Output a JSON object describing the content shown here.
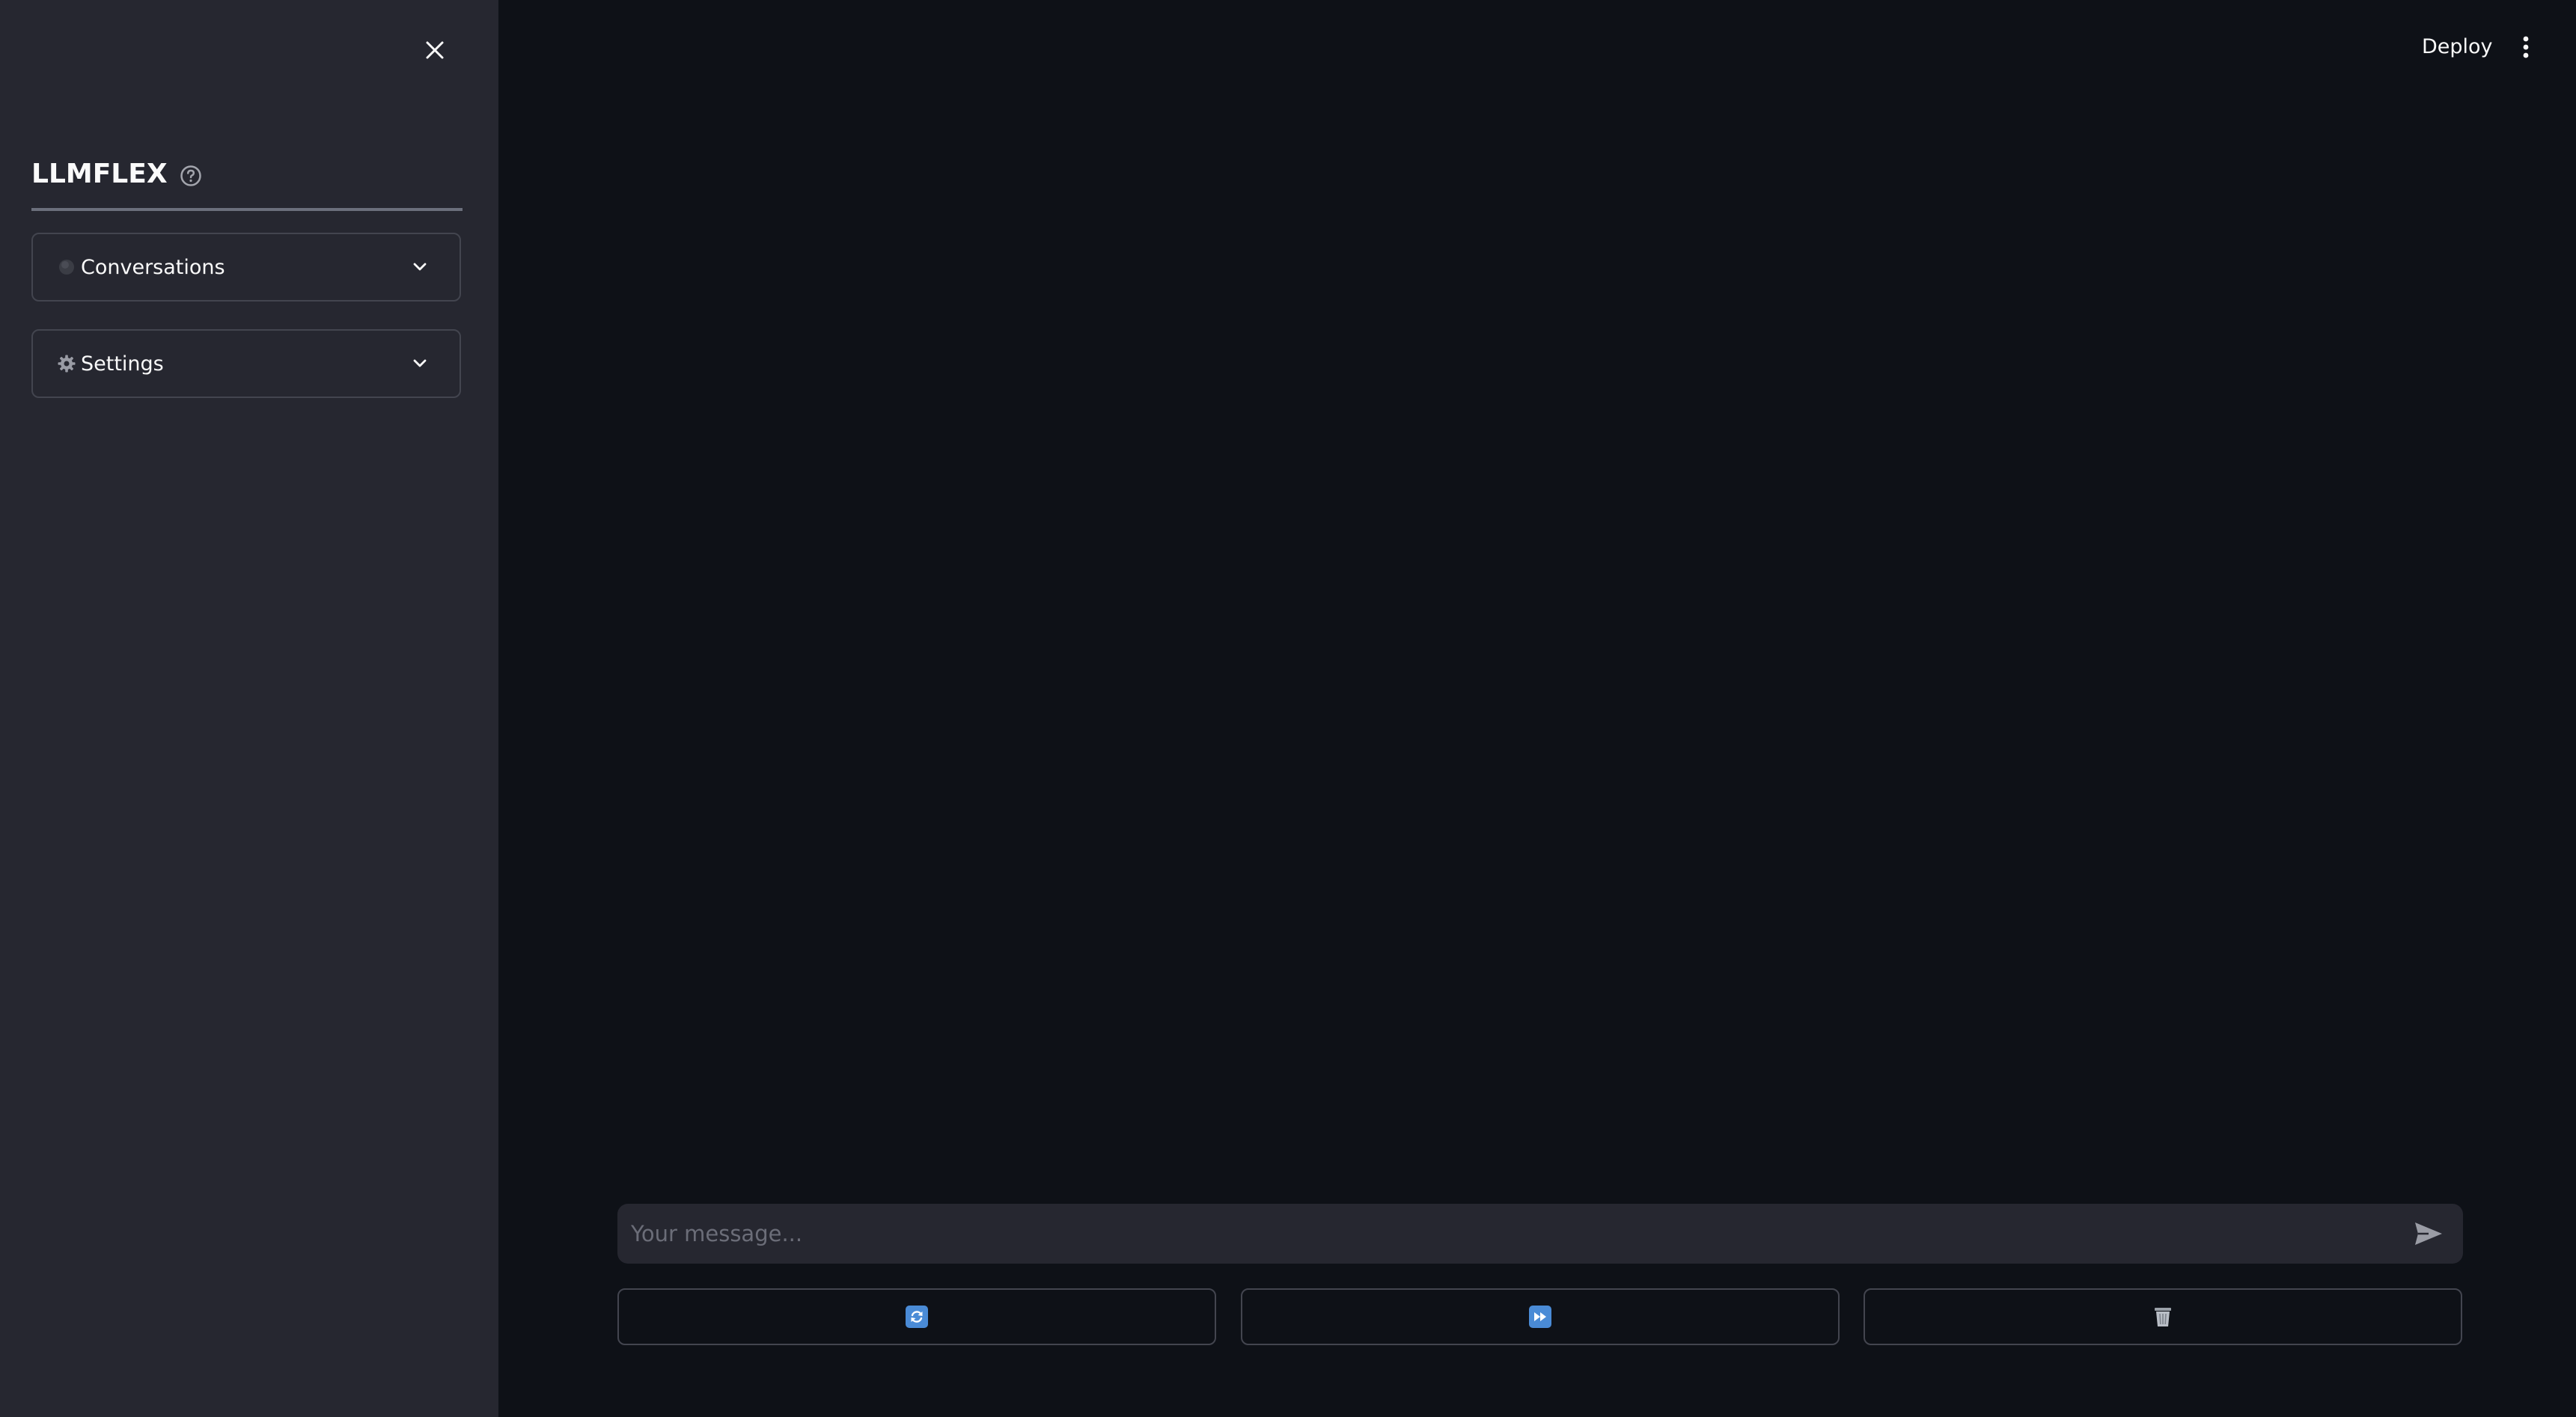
{
  "sidebar": {
    "title": "LLMFLEX",
    "expanders": [
      {
        "label": "Conversations",
        "icon": "dark-circle-icon"
      },
      {
        "label": "Settings",
        "icon": "gear-icon"
      }
    ]
  },
  "header": {
    "deploy_label": "Deploy"
  },
  "chat": {
    "placeholder": "Your message...",
    "actions": [
      {
        "icon": "refresh-icon"
      },
      {
        "icon": "fast-forward-icon"
      },
      {
        "icon": "trash-icon"
      }
    ]
  },
  "colors": {
    "main_background": "#0e1117",
    "sidebar_background": "#262730",
    "text": "#fafafa",
    "border": "#43454f",
    "accent_blue": "#4a8bd6"
  }
}
